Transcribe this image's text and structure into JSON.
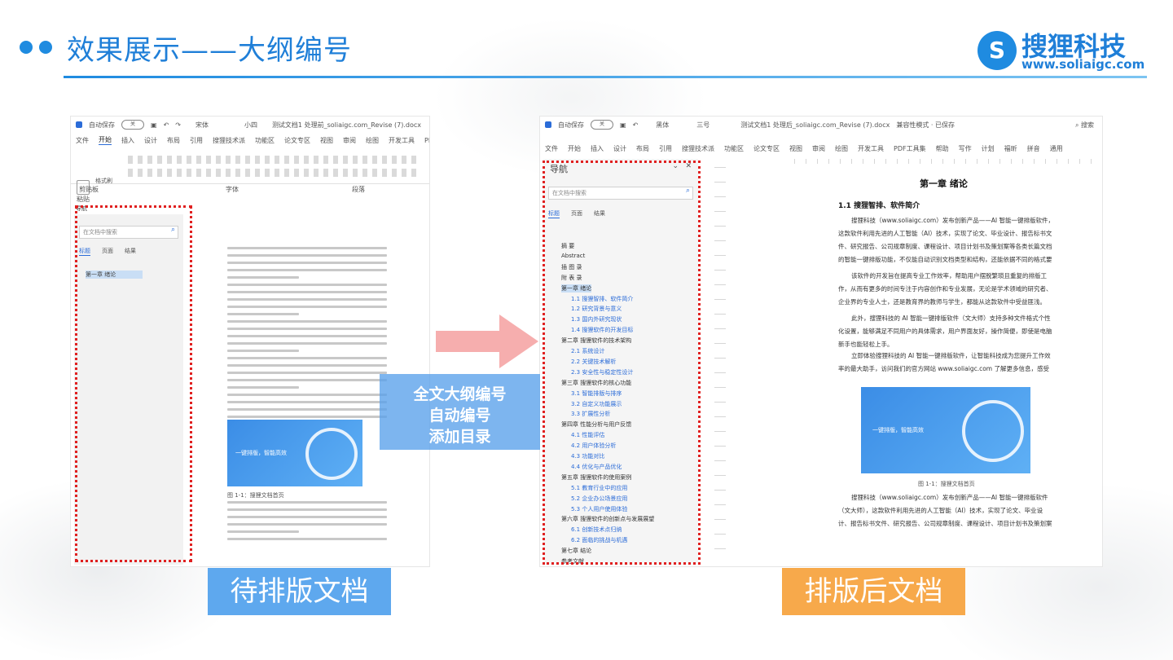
{
  "header": {
    "title": "效果展示——大纲编号",
    "logo_name": "搜狸科技",
    "logo_url": "www.soliaigc.com",
    "logo_mark": "S"
  },
  "left_doc": {
    "autosave": "自动保存",
    "toggle": "关",
    "font_name": "宋体",
    "font_size": "小四",
    "filename": "测试文档1 处理前_soliaigc.com_Revise (7).docx",
    "menu": [
      "文件",
      "开始",
      "插入",
      "设计",
      "布局",
      "引用",
      "搜狸技术派",
      "功能区",
      "论文专区",
      "视图",
      "审阅",
      "绘图",
      "开发工具",
      "PDF工具"
    ],
    "active_menu": "开始",
    "paste": "粘贴",
    "format_painter": "格式刷",
    "ribbon_labels": [
      "剪贴板",
      "字体",
      "段落"
    ],
    "nav_title": "导航",
    "nav_search": "在文档中搜索",
    "nav_tabs": [
      "标题",
      "页面",
      "结果"
    ],
    "nav_item": "第一章 绪论",
    "image_text": "一键排版，智能高效",
    "figure_caption": "图 1-1：搜狸文档首页"
  },
  "right_doc": {
    "autosave": "自动保存",
    "toggle": "关",
    "font_name": "黑体",
    "font_size": "三号",
    "filename": "测试文档1 处理后_soliaigc.com_Revise (7).docx",
    "compat": "兼容性模式 · 已保存",
    "search": "搜索",
    "menu": [
      "文件",
      "开始",
      "插入",
      "设计",
      "布局",
      "引用",
      "搜狸技术派",
      "功能区",
      "论文专区",
      "视图",
      "审阅",
      "绘图",
      "开发工具",
      "PDF工具集",
      "帮助",
      "写作",
      "计划",
      "福昕",
      "拼音",
      "通用"
    ],
    "nav_title": "导航",
    "nav_search": "在文档中搜索",
    "nav_tabs": [
      "标题",
      "页面",
      "结果"
    ],
    "nav_items": [
      "摘 要",
      "Abstract",
      "插 图 录",
      "附 表 录",
      "第一章 绪论",
      "1.1 搜狸智排、软件简介",
      "1.2 研究背景与意义",
      "1.3 国内外研究现状",
      "1.4 搜狸软件的开发目标",
      "第二章 搜狸软件的技术架构",
      "2.1 系统设计",
      "2.2 关键技术解析",
      "2.3 安全性与稳定性设计",
      "第三章 搜狸软件的核心功能",
      "3.1 智能排版与排序",
      "3.2 自定义功能展示",
      "3.3 扩展性分析",
      "第四章 性能分析与用户反馈",
      "4.1 性能评估",
      "4.2 用户体验分析",
      "4.3 功能对比",
      "4.4 优化与产品优化",
      "第五章 搜狸软件的使用案例",
      "5.1 教育行业中的应用",
      "5.2 企业办公场景应用",
      "5.3 个人用户使用体验",
      "第六章 搜狸软件的创新点与发展展望",
      "6.1 创新技术点归纳",
      "6.2 面临的挑战与机遇",
      "第七章 结论",
      "参考文献",
      "致 谢"
    ],
    "chapter_title": "第一章 绪论",
    "section_title": "1.1 搜狸智排、软件简介",
    "paragraphs": [
      "搜狸科技（www.soliaigc.com）发布创新产品——AI 智能一键排版软件，这款软件利用先进的人工智能（AI）技术，实现了论文、毕业设计、报告标书文件、研究报告、公司规章制度、课程设计、项目计划书及策划案等各类长篇文档的智能一键排版功能，不仅能自动识别文档类型和结构，还能依据不同的格式要求，快速完成排版任务，大大节省了您的时间和精力。",
      "该软件的开发旨在提高专业工作效率，帮助用户摆脱繁琐且重复的排版工作，从而有更多的时间专注于内容创作和专业发展，无论是学术领域的研究者、企业界的专业人士，还是教育界的教师与学生，都能从这款软件中受益匪浅。",
      "此外，搜狸科技的 AI 智能一键排版软件（文大师）支持多种文件格式个性化设置，能够满足不同用户的具体需求，用户界面友好，操作简便，即使是电脑新手也能轻松上手。",
      "立即体验搜狸科技的 AI 智能一键排版软件，让智能科技成为您提升工作效率的最大助手，访问我们的官方网站 www.soliaigc.com 了解更多信息，感受智能排版带来的便捷和高效。"
    ],
    "figure_caption": "图 1-1：搜狸文档首页",
    "image_text": "一键排版，智能高效",
    "bottom_paragraph": "搜狸科技（www.soliaigc.com）发布创新产品——AI 智能一键排版软件（文大师），这款软件利用先进的人工智能（AI）技术，实现了论文、毕业设计、报告标书文件、研究报告、公司规章制度、课程设计、项目计划书及策划案等各类长"
  },
  "callout": {
    "line1": "全文大纲编号",
    "line2": "自动编号",
    "line3": "添加目录"
  },
  "labels": {
    "before": "待排版文档",
    "after": "排版后文档"
  },
  "colors": {
    "accent": "#1f8be0",
    "dotted_box": "#e02020",
    "arrow": "#f4a0a0",
    "label_before": "#5ea8ee",
    "label_after": "#f7a94b"
  }
}
